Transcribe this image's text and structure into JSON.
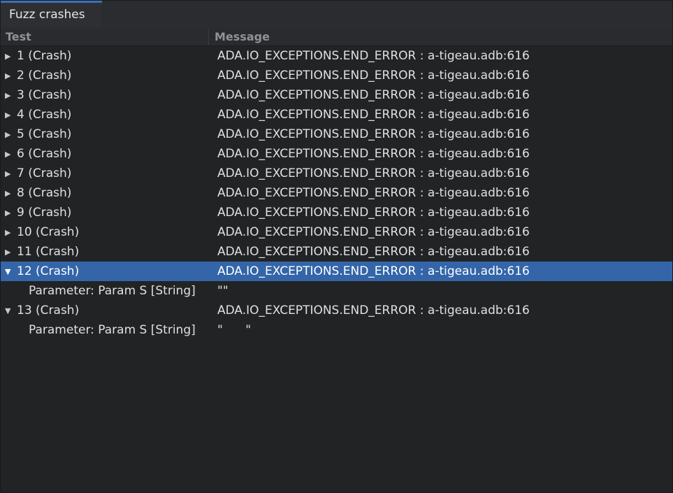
{
  "tab": {
    "label": "Fuzz crashes"
  },
  "columns": {
    "test": "Test",
    "message": "Message"
  },
  "rows": [
    {
      "test": "1 (Crash)",
      "message": "ADA.IO_EXCEPTIONS.END_ERROR : a-tigeau.adb:616",
      "expanded": false
    },
    {
      "test": "2 (Crash)",
      "message": "ADA.IO_EXCEPTIONS.END_ERROR : a-tigeau.adb:616",
      "expanded": false
    },
    {
      "test": "3 (Crash)",
      "message": "ADA.IO_EXCEPTIONS.END_ERROR : a-tigeau.adb:616",
      "expanded": false
    },
    {
      "test": "4 (Crash)",
      "message": "ADA.IO_EXCEPTIONS.END_ERROR : a-tigeau.adb:616",
      "expanded": false
    },
    {
      "test": "5 (Crash)",
      "message": "ADA.IO_EXCEPTIONS.END_ERROR : a-tigeau.adb:616",
      "expanded": false
    },
    {
      "test": "6 (Crash)",
      "message": "ADA.IO_EXCEPTIONS.END_ERROR : a-tigeau.adb:616",
      "expanded": false
    },
    {
      "test": "7 (Crash)",
      "message": "ADA.IO_EXCEPTIONS.END_ERROR : a-tigeau.adb:616",
      "expanded": false
    },
    {
      "test": "8 (Crash)",
      "message": "ADA.IO_EXCEPTIONS.END_ERROR : a-tigeau.adb:616",
      "expanded": false
    },
    {
      "test": "9 (Crash)",
      "message": "ADA.IO_EXCEPTIONS.END_ERROR : a-tigeau.adb:616",
      "expanded": false
    },
    {
      "test": "10 (Crash)",
      "message": "ADA.IO_EXCEPTIONS.END_ERROR : a-tigeau.adb:616",
      "expanded": false
    },
    {
      "test": "11 (Crash)",
      "message": "ADA.IO_EXCEPTIONS.END_ERROR : a-tigeau.adb:616",
      "expanded": false
    },
    {
      "test": "12 (Crash)",
      "message": "ADA.IO_EXCEPTIONS.END_ERROR : a-tigeau.adb:616",
      "expanded": true,
      "selected": true,
      "children": [
        {
          "test": "Parameter: Param S [String]",
          "message": "\"\""
        }
      ]
    },
    {
      "test": "13 (Crash)",
      "message": "ADA.IO_EXCEPTIONS.END_ERROR : a-tigeau.adb:616",
      "expanded": true,
      "children": [
        {
          "test": "Parameter: Param S [String]",
          "message": "\"      \""
        }
      ]
    }
  ],
  "icons": {
    "collapsed": "triangle-right",
    "expanded": "triangle-down"
  },
  "colors": {
    "background": "#222325",
    "selection": "#3365a8",
    "tab_accent": "#3c6fb6",
    "header_text": "#8f9296"
  }
}
